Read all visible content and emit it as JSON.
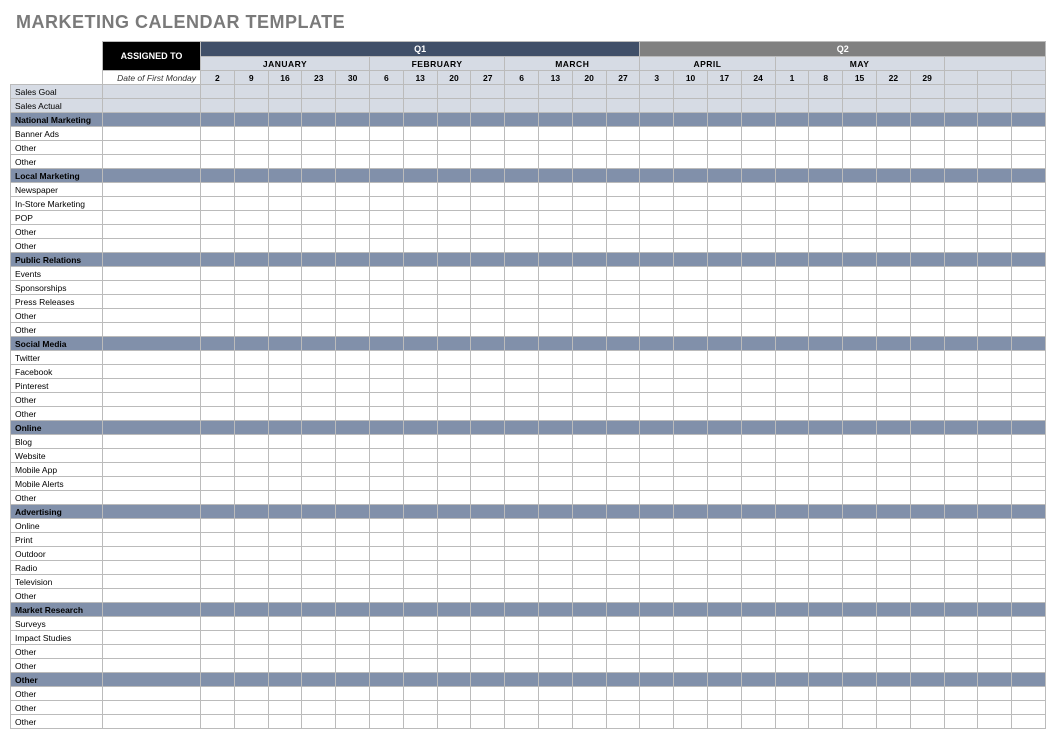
{
  "title": "MARKETING CALENDAR TEMPLATE",
  "headers": {
    "assigned_to": "ASSIGNED TO",
    "date_label": "Date of First Monday",
    "q1": "Q1",
    "q2": "Q2"
  },
  "months": [
    {
      "name": "JANUARY",
      "quarter": "Q1",
      "weeks": [
        "2",
        "9",
        "16",
        "23",
        "30"
      ]
    },
    {
      "name": "FEBRUARY",
      "quarter": "Q1",
      "weeks": [
        "6",
        "13",
        "20",
        "27"
      ]
    },
    {
      "name": "MARCH",
      "quarter": "Q1",
      "weeks": [
        "6",
        "13",
        "20",
        "27"
      ]
    },
    {
      "name": "APRIL",
      "quarter": "Q2",
      "weeks": [
        "3",
        "10",
        "17",
        "24"
      ]
    },
    {
      "name": "MAY",
      "quarter": "Q2",
      "weeks": [
        "1",
        "8",
        "15",
        "22",
        "29"
      ]
    }
  ],
  "q2_extra_cols": 3,
  "sales_rows": [
    "Sales Goal",
    "Sales Actual"
  ],
  "sections": [
    {
      "name": "National Marketing",
      "items": [
        "Banner Ads",
        "Other",
        "Other"
      ]
    },
    {
      "name": "Local Marketing",
      "items": [
        "Newspaper",
        "In-Store Marketing",
        "POP",
        "Other",
        "Other"
      ]
    },
    {
      "name": "Public Relations",
      "items": [
        "Events",
        "Sponsorships",
        "Press Releases",
        "Other",
        "Other"
      ]
    },
    {
      "name": "Social Media",
      "items": [
        "Twitter",
        "Facebook",
        "Pinterest",
        "Other",
        "Other"
      ]
    },
    {
      "name": "Online",
      "items": [
        "Blog",
        "Website",
        "Mobile App",
        "Mobile Alerts",
        "Other"
      ]
    },
    {
      "name": "Advertising",
      "items": [
        "Online",
        "Print",
        "Outdoor",
        "Radio",
        "Television",
        "Other"
      ]
    },
    {
      "name": "Market Research",
      "items": [
        "Surveys",
        "Impact Studies",
        "Other",
        "Other"
      ]
    },
    {
      "name": "Other",
      "items": [
        "Other",
        "Other",
        "Other"
      ]
    }
  ]
}
